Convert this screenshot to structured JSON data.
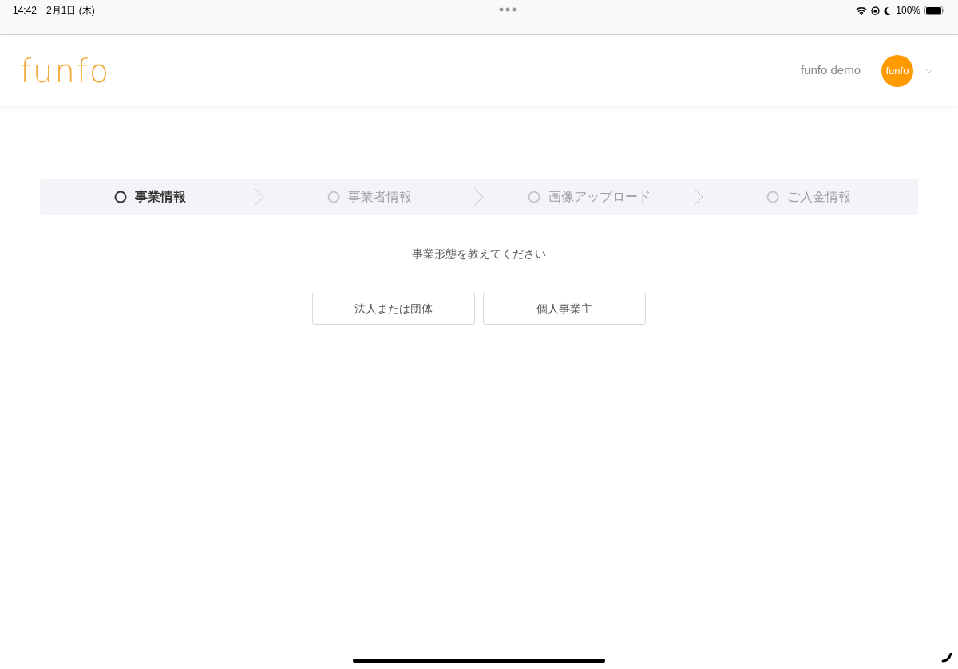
{
  "status_bar": {
    "time": "14:42",
    "date": "2月1日 (木)",
    "battery": "100%"
  },
  "header": {
    "logo": "funfo",
    "user_name": "funfo demo",
    "avatar_text": "funfo"
  },
  "steps": [
    {
      "label": "事業情報",
      "selected": true
    },
    {
      "label": "事業者情報",
      "selected": false
    },
    {
      "label": "画像アップロード",
      "selected": false
    },
    {
      "label": "ご入金情報",
      "selected": false
    }
  ],
  "question": "事業形態を教えてください",
  "options": [
    "法人または団体",
    "個人事業主"
  ]
}
